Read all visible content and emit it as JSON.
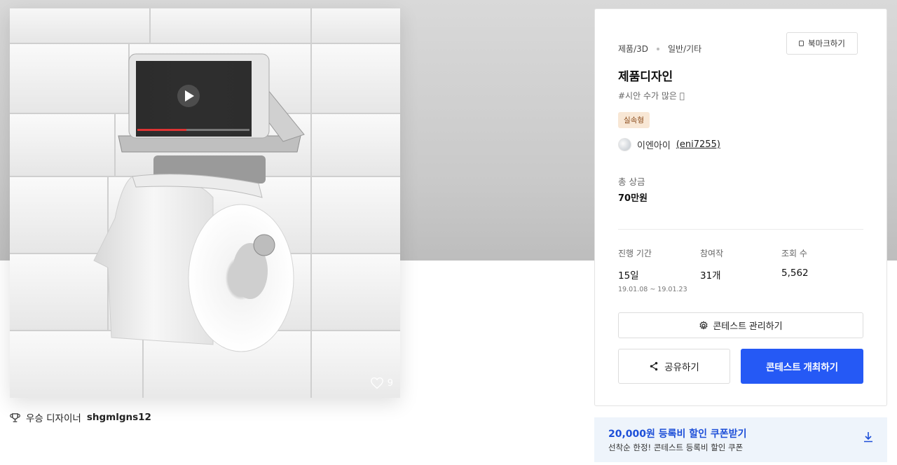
{
  "image_card": {
    "like_count": "9"
  },
  "winner": {
    "prefix": "우승 디자이너",
    "username": "shgmlgns12"
  },
  "contest": {
    "category": "제품/3D",
    "subcategory": "일반/기타",
    "bookmark_label": "북마크하기",
    "title": "제품디자인",
    "tag": "#시안 수가 많은 🏻",
    "badge": "실속형",
    "host_name": "이엔아이",
    "host_id": "(eni7255)",
    "prize_label": "총 상금",
    "prize_value": "70만원",
    "stats": [
      {
        "label": "진행 기간",
        "value": "15일",
        "sub": "19.01.08 ~ 19.01.23"
      },
      {
        "label": "참여작",
        "value": "31개",
        "sub": ""
      },
      {
        "label": "조회 수",
        "value": "5,562",
        "sub": ""
      }
    ],
    "manage_label": "콘테스트 관리하기",
    "share_label": "공유하기",
    "host_contest_label": "콘테스트 개최하기"
  },
  "coupon": {
    "title": "20,000원 등록비 할인 쿠폰받기",
    "subtitle": "선착순 한정! 콘테스트 등록비 할인 쿠폰"
  },
  "colors": {
    "primary": "#2559f5",
    "coupon_bg": "#eef4fb",
    "badge_bg": "#f8e7d5"
  }
}
